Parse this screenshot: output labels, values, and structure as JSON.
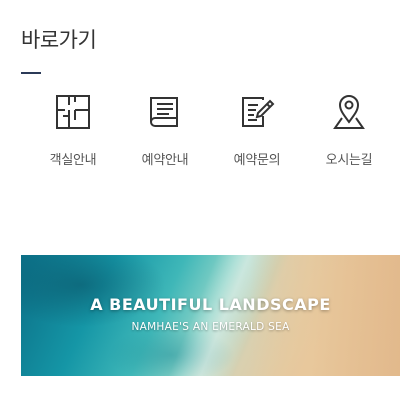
{
  "section": {
    "title": "바로가기"
  },
  "quick_links": [
    {
      "label": "객실안내",
      "icon": "floor-plan-icon"
    },
    {
      "label": "예약안내",
      "icon": "book-icon"
    },
    {
      "label": "예약문의",
      "icon": "edit-document-icon"
    },
    {
      "label": "오시는길",
      "icon": "map-pin-icon"
    }
  ],
  "banner": {
    "title": "A BEAUTIFUL LANDSCAPE",
    "subtitle": "NAMHAE'S AN EMERALD SEA"
  },
  "colors": {
    "accent_bar": "#2b3a57",
    "icon_stroke": "#333333",
    "label_text": "#555555"
  }
}
